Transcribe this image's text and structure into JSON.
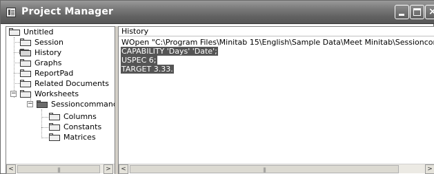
{
  "window": {
    "title": "Project Manager",
    "icon": "project-manager-icon",
    "controls": {
      "minimize": "minimize-icon",
      "maximize": "maximize-icon",
      "close": "close-icon"
    }
  },
  "tree": {
    "root": {
      "label": "Untitled",
      "expander": ""
    },
    "items": [
      {
        "label": "Session"
      },
      {
        "label": "History"
      },
      {
        "label": "Graphs"
      },
      {
        "label": "ReportPad"
      },
      {
        "label": "Related Documents"
      }
    ],
    "worksheets": {
      "label": "Worksheets",
      "expander": "−",
      "child": {
        "label": "Sessioncommands.M",
        "expander": "−",
        "items": [
          {
            "label": "Columns"
          },
          {
            "label": "Constants"
          },
          {
            "label": "Matrices"
          }
        ]
      }
    }
  },
  "scroll": {
    "left_arrow": "<",
    "right_arrow": ">",
    "grip": "|||"
  },
  "history": {
    "header": "History",
    "lines": [
      {
        "text": "WOpen \"C:\\Program Files\\Minitab 15\\English\\Sample Data\\Meet Minitab\\Sessioncommands.MTW\".",
        "selected": false
      },
      {
        "text": "CAPABILITY 'Days' 'Date';",
        "selected": true
      },
      {
        "text": "USPEC 6;",
        "selected": true
      },
      {
        "text": "TARGET 3.33.",
        "selected": true
      }
    ]
  },
  "colors": {
    "title_bar": "#6e6e6e",
    "selection": "#555555"
  }
}
